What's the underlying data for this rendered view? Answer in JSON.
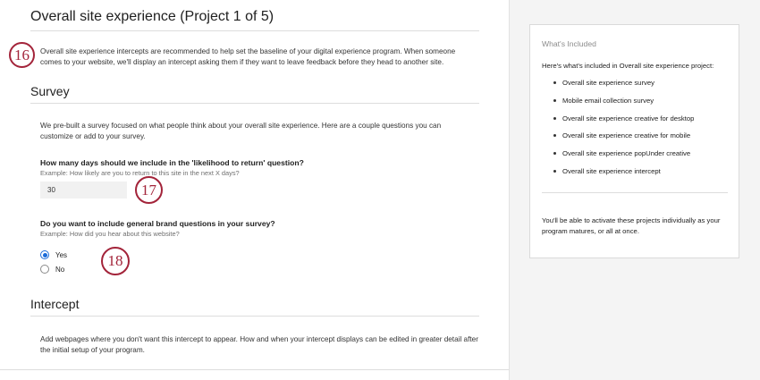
{
  "page": {
    "title": "Overall site experience (Project 1 of 5)",
    "intro": "Overall site experience intercepts are recommended to help set the baseline of your digital experience program. When someone comes to your website, we'll display an intercept asking them if they want to leave feedback before they head to another site."
  },
  "survey": {
    "heading": "Survey",
    "description": "We pre-built a survey focused on what people think about your overall site experience. Here are a couple questions you can customize or add to your survey.",
    "q1": {
      "title": "How many days should we include in the 'likelihood to return' question?",
      "example": "Example: How likely are you to return to this site in the next X days?",
      "value": "30"
    },
    "q2": {
      "title": "Do you want to include general brand questions in your survey?",
      "example": "Example: How did you hear about this website?",
      "options": [
        "Yes",
        "No"
      ],
      "selected": "Yes"
    }
  },
  "intercept": {
    "heading": "Intercept",
    "description": "Add webpages where you don't want this intercept to appear. How and when your intercept displays can be edited in greater detail after the initial setup of your program."
  },
  "callouts": [
    "16",
    "17",
    "18"
  ],
  "sidebar": {
    "title": "What's Included",
    "intro": "Here's what's included in Overall site experience project:",
    "items": [
      "Overall site experience survey",
      "Mobile email collection survey",
      "Overall site experience creative for desktop",
      "Overall site experience creative for mobile",
      "Overall site experience popUnder creative",
      "Overall site experience intercept"
    ],
    "note": "You'll be able to activate these projects individually as your program matures, or all at once."
  },
  "colors": {
    "callout": "#a3243a",
    "radio_selected": "#1b6bd8",
    "sidebar_bg": "#f4f4f4"
  }
}
